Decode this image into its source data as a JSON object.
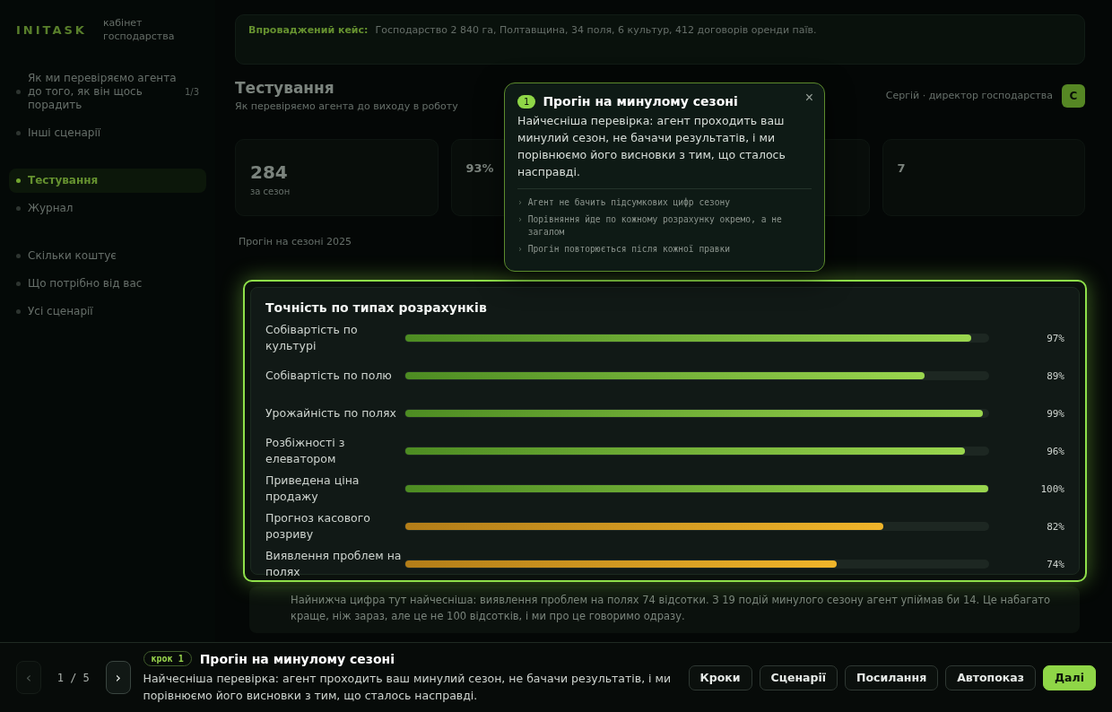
{
  "sidebar": {
    "logo": "INITASK",
    "subtitle": "кабінет господарства",
    "sections": [
      {
        "items": [
          {
            "label": "Як ми перевіряємо агента до того, як він щось порадить",
            "count": "1/3",
            "selected": false
          },
          {
            "label": "Інші сценарії",
            "selected": false
          }
        ]
      },
      {
        "items": [
          {
            "label": "Тестування",
            "selected": true
          },
          {
            "label": "Журнал",
            "selected": false
          }
        ]
      },
      {
        "items": [
          {
            "label": "Скільки коштує",
            "selected": false
          },
          {
            "label": "Що потрібно від вас",
            "selected": false
          },
          {
            "label": "Усі сценарії",
            "selected": false
          }
        ]
      }
    ]
  },
  "banner": {
    "label": "Впроваджений кейс:",
    "text": "Господарство 2 840 га, Полтавщина, 34 поля, 6 культур, 412 договорів оренди паїв."
  },
  "page": {
    "title": "Тестування",
    "subtitle": "Як перевіряємо агента до виходу в роботу",
    "user": "Сергій · директор господарства",
    "avatar": "С"
  },
  "stats": [
    {
      "kind": "big",
      "value": "284",
      "note": "за сезон"
    },
    {
      "kind": "small",
      "value": "93%"
    },
    {
      "kind": "blank"
    },
    {
      "kind": "small",
      "value": "7"
    }
  ],
  "section_title": "Прогін на сезоні 2025",
  "accuracy": {
    "title": "Точність по типах розрахунків",
    "rows": [
      {
        "label": "Собівартість по культурі",
        "level": 0.97,
        "reading": "97%",
        "kind": "good"
      },
      {
        "label": "Собівартість по полю",
        "level": 0.89,
        "reading": "89%",
        "kind": "good"
      },
      {
        "label": "Урожайність по полях",
        "level": 0.99,
        "reading": "99%",
        "kind": "good"
      },
      {
        "label": "Розбіжності з елеватором",
        "level": 0.96,
        "reading": "96%",
        "kind": "good"
      },
      {
        "label": "Приведена ціна продажу",
        "level": 1,
        "reading": "100%",
        "kind": "good"
      },
      {
        "label": "Прогноз касового розриву",
        "level": 0.82,
        "reading": "82%",
        "kind": "warn"
      },
      {
        "label": "Виявлення проблем на полях",
        "level": 0.74,
        "reading": "74%",
        "kind": "warn"
      }
    ]
  },
  "note": "Найнижча цифра тут найчесніша: виявлення проблем на полях 74 відсотки. З 19 подій минулого сезону агент упіймав би 14. Це набагато краще, ніж зараз, але це не 100 відсотків, і ми про це говоримо одразу.",
  "popover": {
    "number": "1",
    "title": "Прогін на минулому сезоні",
    "text": "Найчесніша перевірка: агент проходить ваш минулий сезон, не бачачи результатів, і ми порівнюємо його висновки з тим, що сталось насправді.",
    "close": "×",
    "bullet": "›",
    "points": [
      "Агент не бачить підсумкових цифр сезону",
      "Порівняння йде по кожному розрахунку окремо, а не загалом",
      "Прогін повторюється після кожної правки"
    ]
  },
  "tour": {
    "prev": "‹",
    "next": "›",
    "prev_disabled": true,
    "counter": "1 / 5",
    "badge": "крок 1",
    "title": "Прогін на минулому сезоні",
    "text": "Найчесніша перевірка: агент проходить ваш минулий сезон, не бачачи результатів, і ми порівнюємо його висновки з тим, що сталось насправді.",
    "buttons": [
      {
        "label": "Кроки",
        "primary": false
      },
      {
        "label": "Сценарії",
        "primary": false
      },
      {
        "label": "Посилання",
        "primary": false
      },
      {
        "label": "Автопоказ",
        "primary": false
      },
      {
        "label": "Далі",
        "primary": true
      }
    ]
  }
}
